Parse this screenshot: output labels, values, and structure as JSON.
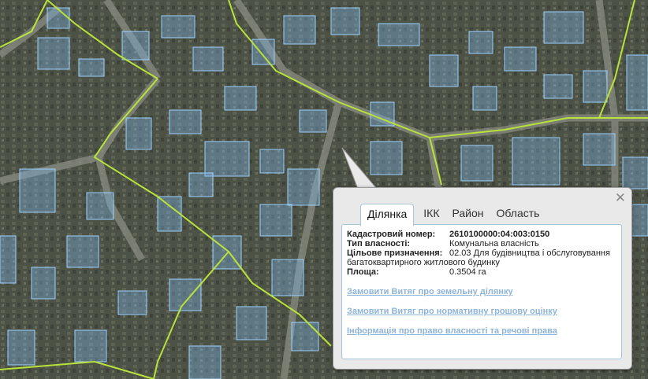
{
  "popup": {
    "close_icon": "close-icon",
    "tabs": [
      "Ділянка",
      "ІКК",
      "Район",
      "Область"
    ],
    "active_tab": 0,
    "fields": {
      "cadastral_label": "Кадастровий номер:",
      "cadastral_value": "2610100000:04:003:0150",
      "ownership_label": "Тип власності:",
      "ownership_value": "Комунальна власність",
      "purpose_label": "Цільове призначення:",
      "purpose_value": "02.03 Для будівництва і обслуговування",
      "purpose_value_cont": "багатоквартирного житлового будинку",
      "area_label": "Площа:",
      "area_value": "0.3504 га"
    },
    "links": [
      "Замовити Витяг про земельну ділянку",
      "Замовити Витяг про нормативну грошову оцінку",
      "Інформація про право власності та речові права"
    ]
  },
  "colors": {
    "parcel_fill": "#7fb5e8",
    "parcel_stroke": "#9cd0ff",
    "boundary_line": "#b9e23a",
    "link": "#8fb4d9"
  }
}
